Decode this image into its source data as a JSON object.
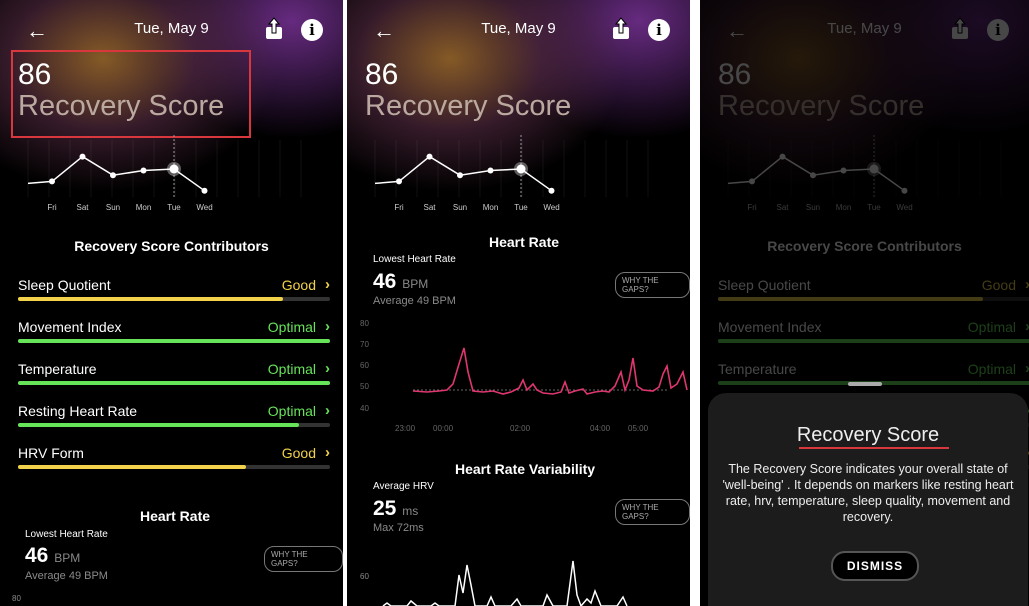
{
  "header": {
    "date": "Tue, May 9",
    "back_icon": "arrow-left-icon",
    "share_icon": "share-icon",
    "info_icon": "info-icon",
    "info_glyph": "i"
  },
  "recovery": {
    "score": "86",
    "label": "Recovery Score"
  },
  "trend": {
    "days": [
      "Fri",
      "Sat",
      "Sun",
      "Mon",
      "Tue",
      "Wed"
    ],
    "values": [
      62,
      78,
      66,
      69,
      70,
      56
    ],
    "selected_index": 4
  },
  "contributors": {
    "title": "Recovery Score Contributors",
    "items": [
      {
        "label": "Sleep Quotient",
        "status": "Good",
        "level": 0.85,
        "color": "#f1d24a"
      },
      {
        "label": "Movement Index",
        "status": "Optimal",
        "level": 1.0,
        "color": "#67e35a"
      },
      {
        "label": "Temperature",
        "status": "Optimal",
        "level": 1.0,
        "color": "#67e35a"
      },
      {
        "label": "Resting Heart Rate",
        "status": "Optimal",
        "level": 0.9,
        "color": "#67e35a"
      },
      {
        "label": "HRV Form",
        "status": "Good",
        "level": 0.73,
        "color": "#f1d24a"
      }
    ],
    "chevron": "›"
  },
  "heart_rate": {
    "title": "Heart Rate",
    "subtitle": "Lowest Heart Rate",
    "value": "46",
    "unit": "BPM",
    "average": "Average 49 BPM",
    "gaps_button": "WHY THE GAPS?",
    "y_ticks": [
      "80",
      "70",
      "60",
      "50",
      "40"
    ],
    "x_ticks": [
      "23:00",
      "00:00",
      "02:00",
      "04:00",
      "05:00"
    ]
  },
  "hrv": {
    "title": "Heart Rate Variability",
    "subtitle": "Average HRV",
    "value": "25",
    "unit": "ms",
    "max": "Max 72ms",
    "gaps_button": "WHY THE GAPS?",
    "y_tick": "60"
  },
  "info_sheet": {
    "title": "Recovery Score",
    "body": "The Recovery Score indicates your overall state of 'well-being' . It depends on markers like resting heart rate, hrv, temperature, sleep quality, movement and recovery.",
    "dismiss": "DISMISS"
  },
  "colors": {
    "good": "#f1d24a",
    "optimal": "#67e35a",
    "heart_line": "#e0366f",
    "highlight": "#d8383d"
  }
}
